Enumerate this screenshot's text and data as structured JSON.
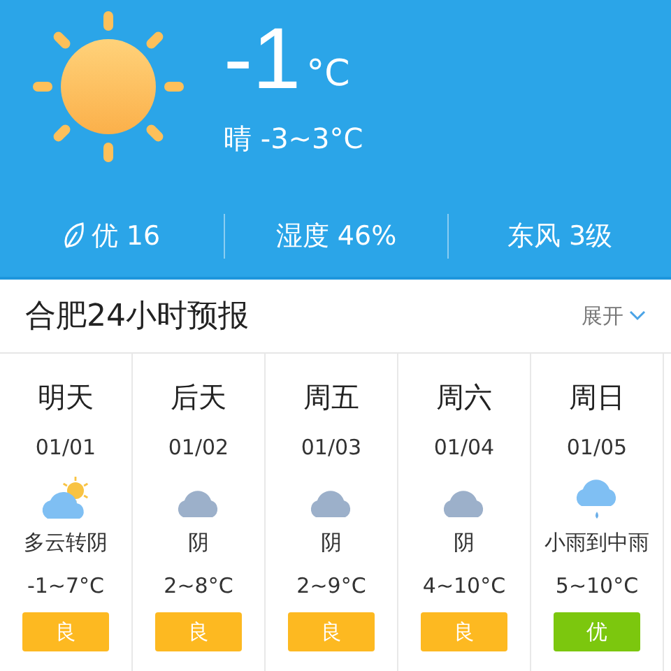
{
  "current": {
    "temperature": "-1",
    "unit": "°C",
    "summary": "晴 -3~3°C"
  },
  "stats": [
    {
      "kind": "air",
      "text": "优 16"
    },
    {
      "kind": "plain",
      "text": "湿度 46%"
    },
    {
      "kind": "plain",
      "text": "东风 3级"
    }
  ],
  "forecast_header": {
    "title": "合肥24小时预报",
    "toggle": "展开"
  },
  "days": [
    {
      "day": "明天",
      "date": "01/01",
      "kind": "partly-cloudy",
      "desc": "多云转阴",
      "temp": "-1~7°C",
      "aqi": "良",
      "color": "#fdb921"
    },
    {
      "day": "后天",
      "date": "01/02",
      "kind": "overcast",
      "desc": "阴",
      "temp": "2~8°C",
      "aqi": "良",
      "color": "#fdb921"
    },
    {
      "day": "周五",
      "date": "01/03",
      "kind": "overcast",
      "desc": "阴",
      "temp": "2~9°C",
      "aqi": "良",
      "color": "#fdb921"
    },
    {
      "day": "周六",
      "date": "01/04",
      "kind": "overcast",
      "desc": "阴",
      "temp": "4~10°C",
      "aqi": "良",
      "color": "#fdb921"
    },
    {
      "day": "周日",
      "date": "01/05",
      "kind": "rain",
      "desc": "小雨到中雨",
      "temp": "5~10°C",
      "aqi": "优",
      "color": "#7cc70e"
    }
  ]
}
